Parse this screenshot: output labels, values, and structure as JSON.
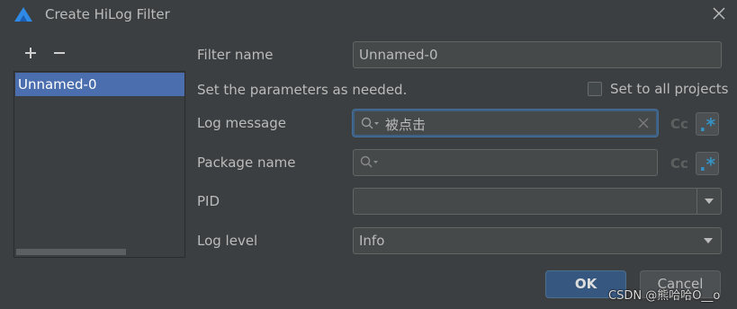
{
  "window": {
    "title": "Create HiLog Filter"
  },
  "sidebar": {
    "add_icon": "plus-icon",
    "remove_icon": "minus-icon",
    "items": [
      {
        "label": "Unnamed-0",
        "selected": true
      }
    ]
  },
  "form": {
    "filter_name_label": "Filter name",
    "filter_name_value": "Unnamed-0",
    "instructions": "Set the parameters as needed.",
    "set_to_all_projects_label": "Set to all projects",
    "set_to_all_projects_checked": false,
    "log_message_label": "Log message",
    "log_message_value": "被点击",
    "package_name_label": "Package name",
    "package_name_value": "",
    "pid_label": "PID",
    "pid_value": "",
    "log_level_label": "Log level",
    "log_level_value": "Info",
    "match_case_label": "Cc",
    "regex_label": ".*"
  },
  "buttons": {
    "ok": "OK",
    "cancel": "Cancel"
  },
  "watermark": "CSDN @熊哈哈O__o",
  "colors": {
    "background": "#3c3f41",
    "selection": "#4b6eaf",
    "ok_button": "#365880",
    "focus_border": "#3d6185",
    "regex_accent": "#3592c4"
  }
}
